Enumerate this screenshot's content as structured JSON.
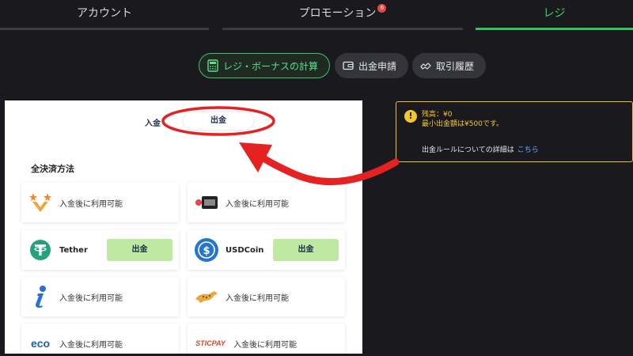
{
  "tabs": [
    {
      "label": "アカウント"
    },
    {
      "label": "プロモーション",
      "badge": "6"
    },
    {
      "label": "レジ"
    }
  ],
  "subnav": {
    "bonus_calc": "レジ・ボーナスの計算",
    "withdraw_request": "出金申請",
    "history": "取引履歴"
  },
  "panel": {
    "deposit_label": "入金",
    "withdraw_label": "出金",
    "section_title": "全決済方法",
    "methods": [
      {
        "icon": "stars-v-logo",
        "text": "入金後に利用可能"
      },
      {
        "icon": "card-logo",
        "text": "入金後に利用可能"
      },
      {
        "icon": "tether-logo",
        "name": "Tether",
        "button": "出金"
      },
      {
        "icon": "usdcoin-logo",
        "name": "USDCoin",
        "button": "出金"
      },
      {
        "icon": "i-logo",
        "text": "入金後に利用可能"
      },
      {
        "icon": "cheetah-logo",
        "text": "入金後に利用可能"
      },
      {
        "icon": "eco-logo",
        "logo_text": "eco",
        "text": "入金後に利用可能"
      },
      {
        "icon": "sticpay-logo",
        "logo_text": "STICPAY",
        "text": "入金後に利用可能"
      }
    ]
  },
  "info": {
    "balance": "残高：¥0",
    "minimum": "最小出金額は¥500です。",
    "rule": "出金ルールについての詳細は",
    "link": "こちら"
  },
  "colors": {
    "accent_green": "#2ec35c",
    "warning_yellow": "#f2c832",
    "annotation_red": "#e42222"
  }
}
